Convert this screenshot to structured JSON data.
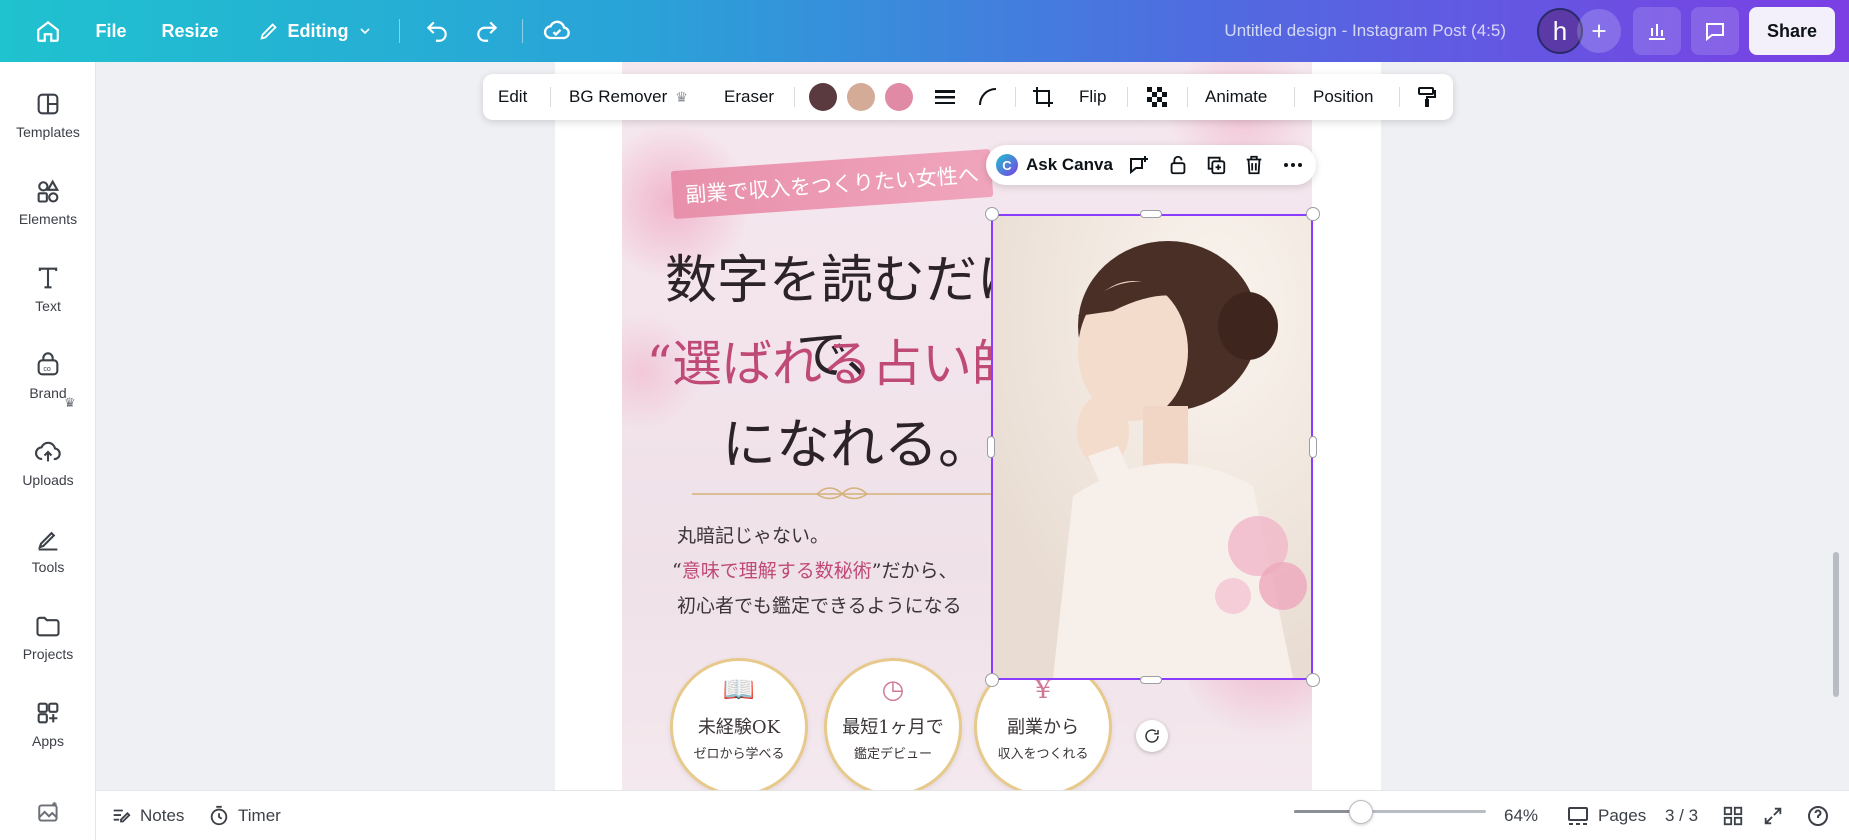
{
  "topbar": {
    "file_label": "File",
    "resize_label": "Resize",
    "editing_label": "Editing",
    "title": "Untitled design - Instagram Post (4:5)",
    "avatar_letter": "h",
    "share_label": "Share"
  },
  "sidebar": {
    "items": [
      {
        "label": "Templates",
        "icon": "templates-icon"
      },
      {
        "label": "Elements",
        "icon": "elements-icon"
      },
      {
        "label": "Text",
        "icon": "text-icon"
      },
      {
        "label": "Brand",
        "icon": "brand-icon"
      },
      {
        "label": "Uploads",
        "icon": "uploads-icon"
      },
      {
        "label": "Tools",
        "icon": "tools-icon"
      },
      {
        "label": "Projects",
        "icon": "projects-icon"
      },
      {
        "label": "Apps",
        "icon": "apps-icon"
      }
    ]
  },
  "context_toolbar": {
    "edit": "Edit",
    "bg_remover": "BG Remover",
    "eraser": "Eraser",
    "colors": [
      "#5a3a3e",
      "#d4ab97",
      "#e08aa5"
    ],
    "flip": "Flip",
    "animate": "Animate",
    "position": "Position"
  },
  "ask_bar": {
    "label": "Ask Canva"
  },
  "design": {
    "ribbon": "副業で収入をつくりたい女性へ",
    "line1": "数字を読むだけで、",
    "line2": "“選ばれる占い師”",
    "line3": "になれる。",
    "body1": "丸暗記じゃない。",
    "body2_pre": "“",
    "body2_pink": "意味で理解する数秘術",
    "body2_post": "”だから、",
    "body3": "初心者でも鑑定できるようになる",
    "badges": [
      {
        "icon": "book-icon",
        "t1": "未経験OK",
        "t2": "ゼロから学べる"
      },
      {
        "icon": "clock-icon",
        "t1": "最短1ヶ月で",
        "t2": "鑑定デビュー"
      },
      {
        "icon": "yen-icon",
        "t1": "副業から",
        "t2": "収入をつくれる"
      }
    ]
  },
  "bottombar": {
    "notes": "Notes",
    "timer": "Timer",
    "zoom": "64%",
    "zoom_fraction": 0.35,
    "pages": "Pages",
    "page_count": "3 / 3"
  },
  "colors": {
    "selection": "#8b3dff",
    "accent_pink": "#c04a76"
  }
}
